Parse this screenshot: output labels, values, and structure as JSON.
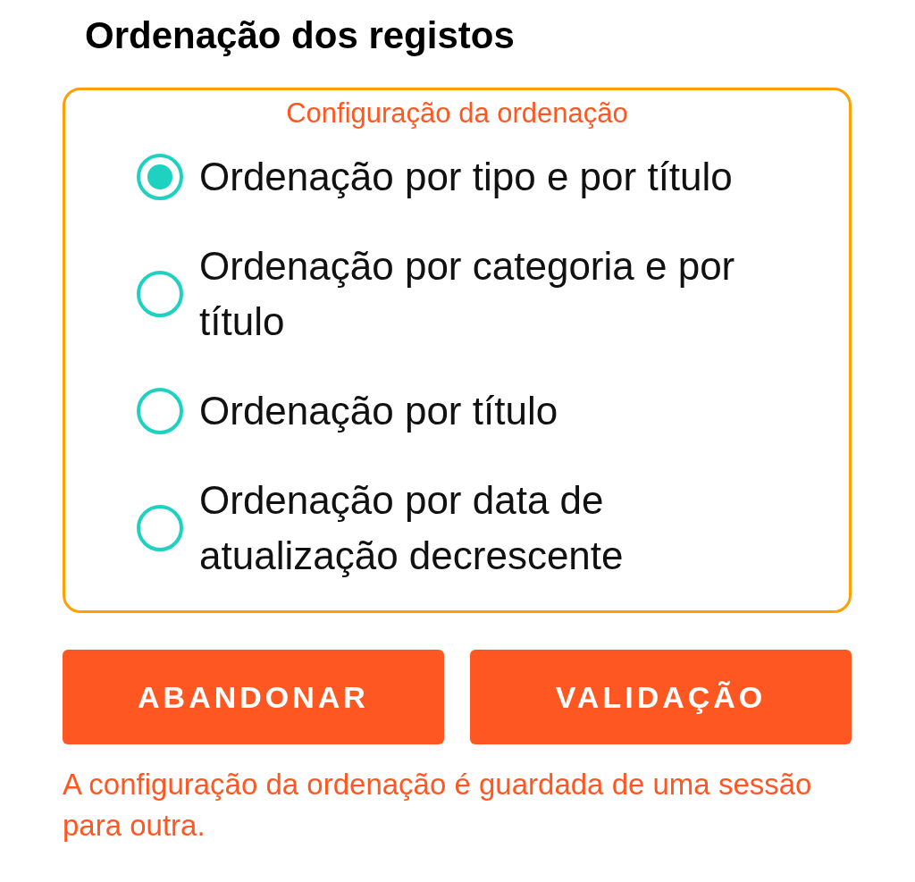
{
  "title": "Ordenação dos registos",
  "group": {
    "legend": "Configuração da ordenação",
    "options": [
      {
        "label": "Ordenação por tipo e por título",
        "selected": true
      },
      {
        "label": "Ordenação por categoria e por título",
        "selected": false
      },
      {
        "label": "Ordenação por título",
        "selected": false
      },
      {
        "label": "Ordenação por data de atualização decrescente",
        "selected": false
      }
    ]
  },
  "buttons": [
    "ABANDONAR",
    "VALIDAÇÃO"
  ],
  "note": "A configuração da ordenação é guardada de uma sessão para outra."
}
